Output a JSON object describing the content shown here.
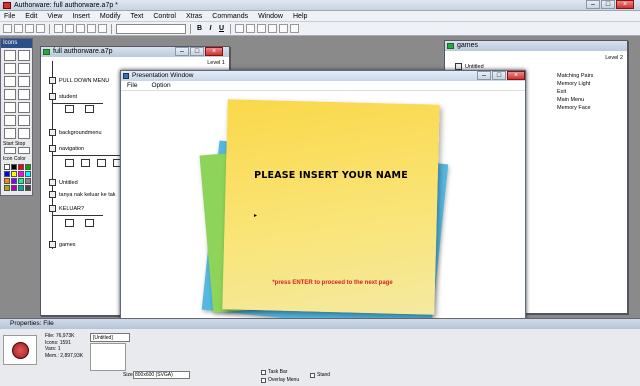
{
  "app": {
    "title": "Authorware: full authorware.a7p *"
  },
  "menu": [
    "File",
    "Edit",
    "View",
    "Insert",
    "Modify",
    "Text",
    "Control",
    "Xtras",
    "Commands",
    "Window",
    "Help"
  ],
  "toolbar": {
    "bold": "B",
    "italic": "I",
    "underline": "U"
  },
  "palette": {
    "title": "Icons",
    "start_label": "Start",
    "stop_label": "Stop",
    "icon_color_label": "Icon Color"
  },
  "colors": [
    "#ffffff",
    "#000000",
    "#ff0000",
    "#00aa00",
    "#0000ff",
    "#ffff00",
    "#ff00ff",
    "#00ffff",
    "#ff8800",
    "#8800ff",
    "#00ff88",
    "#888888",
    "#aaaa00",
    "#aa00aa",
    "#00aaaa",
    "#444444"
  ],
  "flow_window": {
    "title": "full authorware.a7p",
    "level": "Level 1",
    "items": [
      "PULL DOWN MENU",
      "student",
      "backgroundmenu",
      "navigation",
      "Untitled",
      "tanya nak keluar ke tak",
      "KELUAR?",
      "games"
    ]
  },
  "games_window": {
    "title": "games",
    "level": "Level 2",
    "untitled": "Untitled",
    "items": [
      "Matching Pairs",
      "Memory Light",
      "Exit",
      "Main Menu",
      "Memory Face"
    ]
  },
  "presentation": {
    "title": "Presentation Window",
    "menu": [
      "File",
      "Option"
    ],
    "headline": "PLEASE INSERT YOUR NAME",
    "caret": "▸",
    "hint": "*press ENTER to proceed to the next page"
  },
  "properties": {
    "title": "Properties: File",
    "stats": [
      "File: 76,973K",
      "Icons: 1591",
      "Vars: 1",
      "Mem.: 2,897,93K"
    ],
    "untitled": "[Untitled]",
    "size_label": "Size:",
    "size_value": "800x600 (SVGA)",
    "options": [
      "Task Bar",
      "Overlay Menu"
    ],
    "stand_label": "Stand"
  }
}
